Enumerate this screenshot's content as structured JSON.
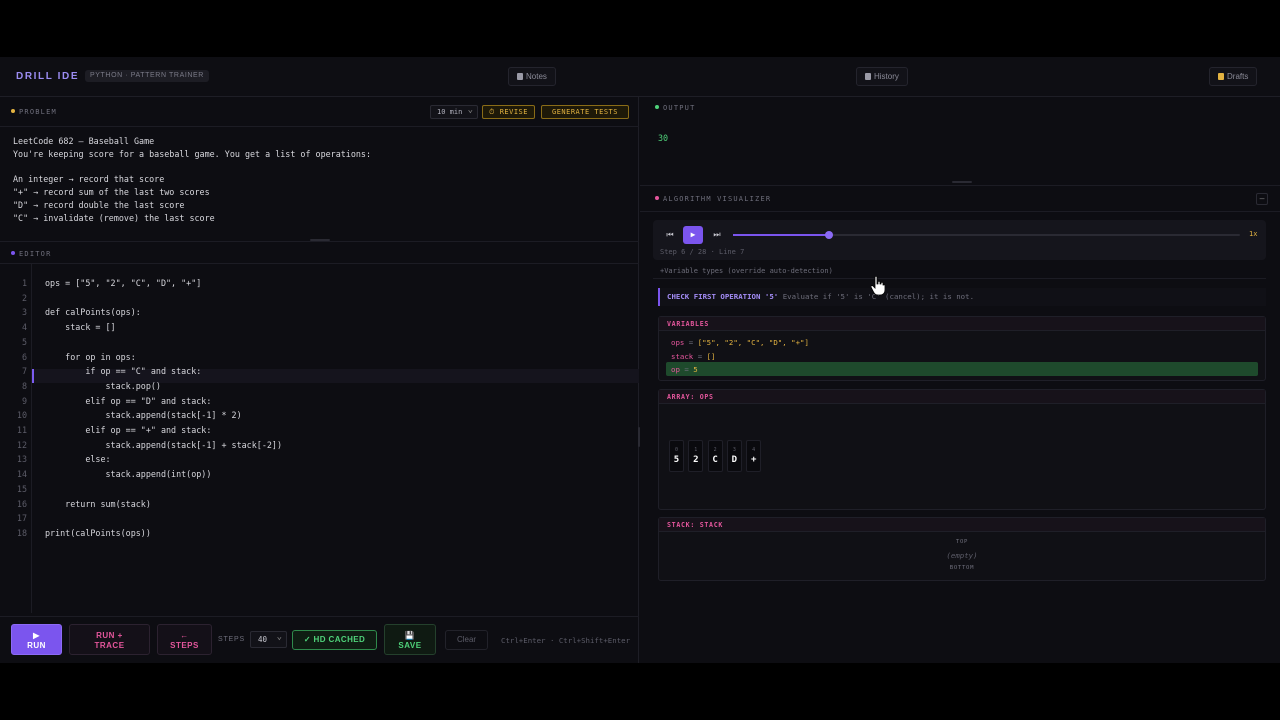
{
  "header": {
    "brand": "DRILL IDE",
    "badge": "PYTHON · PATTERN TRAINER",
    "notes_label": "Notes",
    "history_label": "History",
    "drafts_label": "Drafts"
  },
  "problem": {
    "section_title": "PROBLEM",
    "time_select": "10 min",
    "revise_label": "⏱ REVISE",
    "generate_label": "GENERATE TESTS",
    "text": "LeetCode 682 — Baseball Game\nYou're keeping score for a baseball game. You get a list of operations:\n\nAn integer → record that score\n\"+\" → record sum of the last two scores\n\"D\" → record double the last score\n\"C\" → invalidate (remove) the last score"
  },
  "editor": {
    "section_title": "EDITOR",
    "lines": [
      "ops = [\"5\", \"2\", \"C\", \"D\", \"+\"]",
      "",
      "def calPoints(ops):",
      "    stack = []",
      "",
      "    for op in ops:",
      "        if op == \"C\" and stack:",
      "            stack.pop()",
      "        elif op == \"D\" and stack:",
      "            stack.append(stack[-1] * 2)",
      "        elif op == \"+\" and stack:",
      "            stack.append(stack[-1] + stack[-2])",
      "        else:",
      "            stack.append(int(op))",
      "",
      "    return sum(stack)",
      "",
      "print(calPoints(ops))"
    ],
    "line_numbers": [
      "1",
      "2",
      "3",
      "4",
      "5",
      "6",
      "7",
      "8",
      "9",
      "10",
      "11",
      "12",
      "13",
      "14",
      "15",
      "16",
      "17",
      "18"
    ]
  },
  "runbar": {
    "run_label": "RUN",
    "trace_label": "RUN +\nTRACE",
    "steps_btn_label": "STEPS",
    "steps_label": "STEPS",
    "steps_value": "40",
    "hd_label": "✓ HD CACHED",
    "save_label": "SAVE",
    "clear_label": "Clear",
    "shortcut": "Ctrl+Enter · Ctrl+Shift+Enter"
  },
  "output": {
    "section_title": "OUTPUT",
    "value": "30"
  },
  "visualizer": {
    "section_title": "ALGORITHM VISUALIZER",
    "speed": "1x",
    "step_info": "Step 6 / 28 · Line 7",
    "progress": 0.19,
    "var_types": "+Variable types (override auto-detection)",
    "check_bold": "CHECK FIRST OPERATION '5'",
    "check_text": " Evaluate if '5' is 'C' (cancel); it is not.",
    "variables_title": "VARIABLES",
    "variables": [
      {
        "name": "ops",
        "value": "[\"5\", \"2\", \"C\", \"D\", \"+\"]"
      },
      {
        "name": "stack",
        "value": "[]"
      },
      {
        "name": "op",
        "value": "5"
      }
    ],
    "array_title": "ARRAY: OPS",
    "array": [
      {
        "idx": "0",
        "val": "5"
      },
      {
        "idx": "1",
        "val": "2"
      },
      {
        "idx": "2",
        "val": "C"
      },
      {
        "idx": "3",
        "val": "D"
      },
      {
        "idx": "4",
        "val": "+"
      }
    ],
    "stack_title": "STACK: STACK",
    "stack_top": "TOP",
    "stack_empty": "(empty)",
    "stack_bottom": "BOTTOM"
  },
  "colors": {
    "accent": "#7b55ee",
    "pink": "#e4569c",
    "amber": "#e3b341",
    "green": "#4fd27a"
  }
}
